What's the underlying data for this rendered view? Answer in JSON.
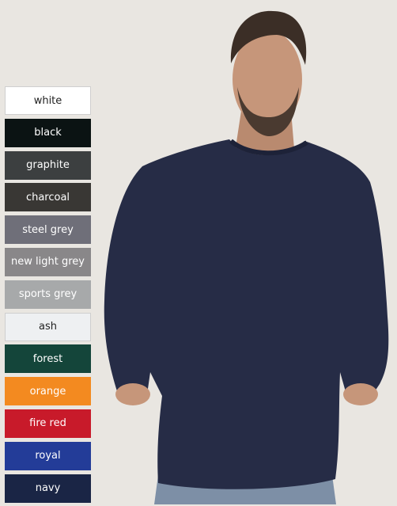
{
  "colors": {
    "background": "#e9e6e1",
    "sweatshirt": "#262c46",
    "skin": "#c6967a",
    "hair": "#3b2e26",
    "jeans": "#7d8fa6"
  },
  "swatches": [
    {
      "label": "white",
      "color": "#ffffff",
      "text_color": "#222222"
    },
    {
      "label": "black",
      "color": "#0b1313",
      "text_color": "#ffffff"
    },
    {
      "label": "graphite",
      "color": "#3c3f40",
      "text_color": "#ffffff"
    },
    {
      "label": "charcoal",
      "color": "#393734",
      "text_color": "#ffffff"
    },
    {
      "label": "steel grey",
      "color": "#6f6f79",
      "text_color": "#ffffff"
    },
    {
      "label": "new light grey",
      "color": "#898789",
      "text_color": "#ffffff"
    },
    {
      "label": "sports grey",
      "color": "#a7a9aa",
      "text_color": "#ffffff"
    },
    {
      "label": "ash",
      "color": "#eef0f2",
      "text_color": "#222222"
    },
    {
      "label": "forest",
      "color": "#14453a",
      "text_color": "#ffffff"
    },
    {
      "label": "orange",
      "color": "#f38a20",
      "text_color": "#ffffff"
    },
    {
      "label": "fire red",
      "color": "#c81a2a",
      "text_color": "#ffffff"
    },
    {
      "label": "royal",
      "color": "#233c98",
      "text_color": "#ffffff"
    },
    {
      "label": "navy",
      "color": "#1a2545",
      "text_color": "#ffffff"
    }
  ]
}
